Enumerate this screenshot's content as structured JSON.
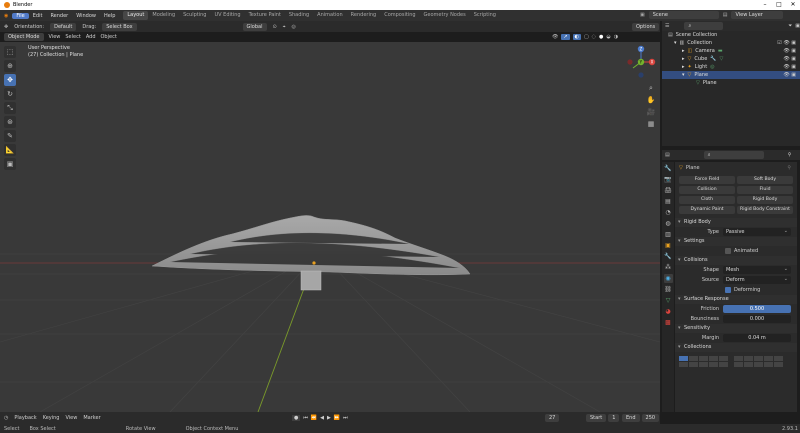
{
  "window": {
    "title": "Blender"
  },
  "menubar": {
    "menus": [
      "File",
      "Edit",
      "Render",
      "Window",
      "Help"
    ],
    "workspaces": [
      "Layout",
      "Modeling",
      "Sculpting",
      "UV Editing",
      "Texture Paint",
      "Shading",
      "Animation",
      "Rendering",
      "Compositing",
      "Geometry Nodes",
      "Scripting"
    ],
    "active_workspace": "Layout",
    "scene": "Scene",
    "view_layer": "View Layer"
  },
  "header": {
    "orientation_label": "Orientation:",
    "orientation_value": "Default",
    "drag_label": "Drag:",
    "drag_value": "Select Box",
    "transform_space": "Global",
    "options": "Options"
  },
  "viewport_header": {
    "mode": "Object Mode",
    "menus": [
      "View",
      "Select",
      "Add",
      "Object"
    ]
  },
  "viewport": {
    "overlay_line1": "User Perspective",
    "overlay_line2": "(27) Collection | Plane"
  },
  "gizmo": {
    "x": "X",
    "y": "Y",
    "z": "Z"
  },
  "timeline": {
    "menus": [
      "Playback",
      "Keying",
      "View",
      "Marker"
    ],
    "current_frame": "27",
    "start_label": "Start",
    "start_value": "1",
    "end_label": "End",
    "end_value": "250"
  },
  "statusbar": {
    "items": [
      "Select",
      "Box Select",
      "Rotate View",
      "Object Context Menu"
    ],
    "version": "2.93.1"
  },
  "outliner": {
    "rows": [
      {
        "label": "Scene Collection",
        "indent": 0
      },
      {
        "label": "Collection",
        "indent": 1
      },
      {
        "label": "Camera",
        "indent": 2
      },
      {
        "label": "Cube",
        "indent": 2
      },
      {
        "label": "Light",
        "indent": 2
      },
      {
        "label": "Plane",
        "indent": 2
      },
      {
        "label": "Plane",
        "indent": 3
      }
    ]
  },
  "properties": {
    "object_name": "Plane",
    "physics_buttons": [
      [
        "Force Field",
        "Soft Body"
      ],
      [
        "Collision",
        "Fluid"
      ],
      [
        "Cloth",
        "Rigid Body"
      ],
      [
        "Dynamic Paint",
        "Rigid Body Constraint"
      ]
    ],
    "rigid_body_title": "Rigid Body",
    "type_label": "Type",
    "type_value": "Passive",
    "settings_title": "Settings",
    "animated_label": "Animated",
    "collisions_title": "Collisions",
    "shape_label": "Shape",
    "shape_value": "Mesh",
    "source_label": "Source",
    "source_value": "Deform",
    "deforming_label": "Deforming",
    "surface_title": "Surface Response",
    "friction_label": "Friction",
    "friction_value": "0.500",
    "bounciness_label": "Bounciness",
    "bounciness_value": "0.000",
    "sensitivity_title": "Sensitivity",
    "margin_label": "Margin",
    "margin_value": "0.04 m",
    "collections_title": "Collections"
  }
}
